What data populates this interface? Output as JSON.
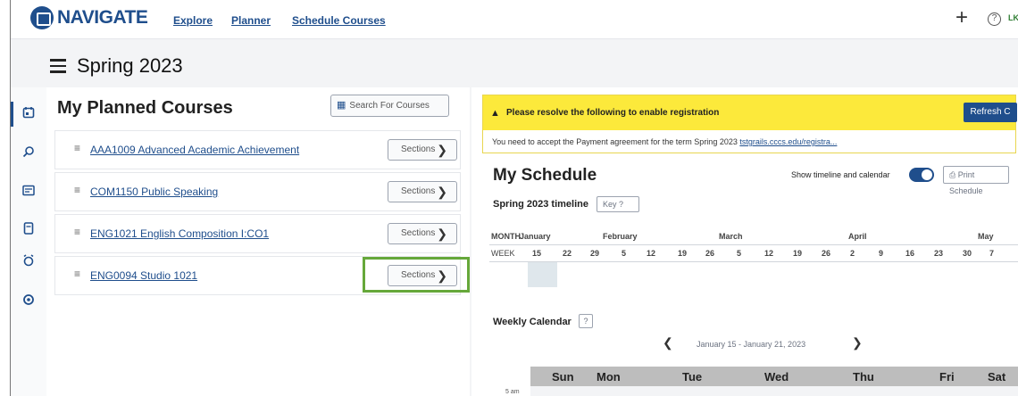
{
  "nav": {
    "brand": "NAVIGATE",
    "links": [
      "Explore",
      "Planner",
      "Schedule Courses"
    ],
    "plus": "+",
    "help": "?",
    "user": "LK"
  },
  "term": {
    "title": "Spring 2023"
  },
  "rail": {
    "icons": [
      "calendar-icon",
      "search-icon",
      "course-list-icon",
      "notebook-icon",
      "alarm-icon",
      "settings-icon"
    ]
  },
  "planned": {
    "title": "My Planned Courses",
    "search_label": "Search For Courses",
    "courses": [
      {
        "name": "AAA1009 Advanced Academic Achievement",
        "button": "Sections"
      },
      {
        "name": "COM1150 Public Speaking",
        "button": "Sections"
      },
      {
        "name": "ENG1021 English Composition I:CO1",
        "button": "Sections"
      },
      {
        "name": "ENG0094 Studio 1021",
        "button": "Sections"
      }
    ],
    "drag_glyph": "≡",
    "chevron": "❯"
  },
  "alert": {
    "warn_glyph": "▲",
    "title": "Please resolve the following to enable registration",
    "refresh": "Refresh C",
    "message": "You need to accept the Payment agreement for the term Spring 2023",
    "link": "tstgrails.cccs.edu/registra..."
  },
  "schedule": {
    "title": "My Schedule",
    "toggle_label": "Show timeline and calendar",
    "toggle_on": true,
    "print": "Print Schedule",
    "timeline_title": "Spring 2023 timeline",
    "key": "Key ?",
    "month_label": "MONTH",
    "week_label": "WEEK",
    "months": [
      "January",
      "February",
      "March",
      "April",
      "May"
    ],
    "weeks": [
      "15",
      "22",
      "29",
      "5",
      "12",
      "19",
      "26",
      "5",
      "12",
      "19",
      "26",
      "2",
      "9",
      "16",
      "23",
      "30",
      "7"
    ],
    "weekly_title": "Weekly Calendar",
    "weekly_help": "?",
    "prev": "❮",
    "next": "❯",
    "range": "January 15 - January 21, 2023",
    "days": [
      "Sun",
      "Mon",
      "Tue",
      "Wed",
      "Thu",
      "Fri",
      "Sat"
    ],
    "first_time": "5 am"
  },
  "colors": {
    "brand": "#1f4e8c",
    "alert": "#fce93b",
    "highlight": "#66a83a"
  }
}
